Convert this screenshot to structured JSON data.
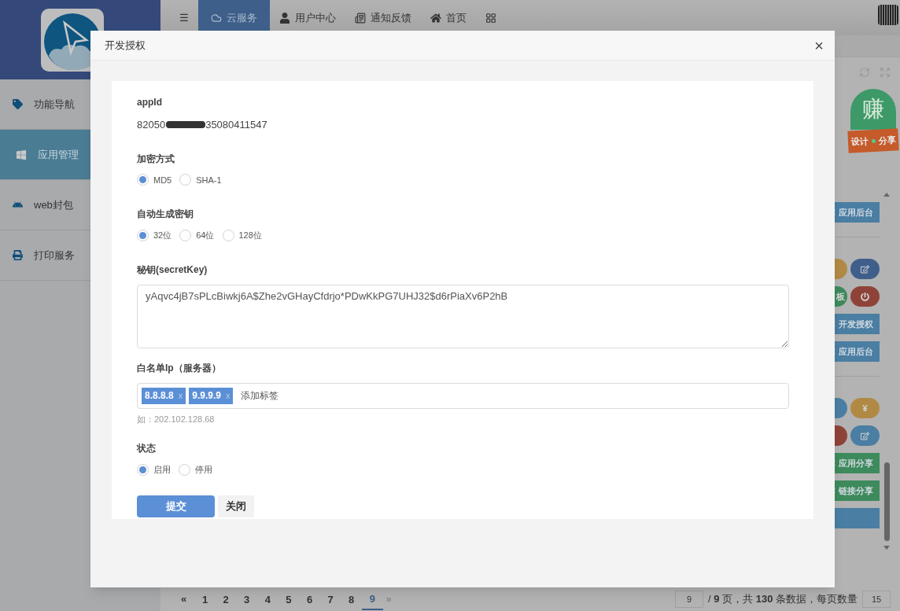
{
  "sidebar": {
    "items": [
      {
        "label": "功能导航",
        "selected": false
      },
      {
        "label": "应用管理",
        "selected": true
      },
      {
        "label": "web封包",
        "selected": false
      },
      {
        "label": "打印服务",
        "selected": false
      }
    ]
  },
  "top_nav": {
    "items": [
      {
        "label": "☰",
        "selected": false
      },
      {
        "label": "云服务",
        "selected": true
      },
      {
        "label": "用户中心",
        "selected": false
      },
      {
        "label": "通知反馈",
        "selected": false
      },
      {
        "label": "首页",
        "selected": false
      },
      {
        "selected": false
      }
    ]
  },
  "promo_badge": {
    "main": "赚",
    "left": "设计",
    "right": "分享"
  },
  "background_actions": [
    {
      "kind": "bar",
      "color": "#4a7ea3",
      "label": "应用后台"
    },
    {
      "kind": "divider"
    },
    {
      "kind": "pills",
      "left": {
        "color": "#b08a45"
      },
      "right": {
        "color": "#3f5f8a",
        "kind": "edit"
      }
    },
    {
      "kind": "pills",
      "left": {
        "color": "#3d8a5c",
        "label": "板"
      },
      "right": {
        "color": "#8f4338",
        "kind": "power"
      }
    },
    {
      "kind": "bar",
      "color": "#4a7ea3",
      "label": "开发授权"
    },
    {
      "kind": "bar",
      "color": "#4a7ea3",
      "label": "应用后台"
    },
    {
      "kind": "divider"
    },
    {
      "kind": "pills",
      "left": {
        "color": "#4a7ea3"
      },
      "right": {
        "color": "#b08a45",
        "label": "¥"
      }
    },
    {
      "kind": "pills",
      "left": {
        "color": "#8f4338"
      },
      "right": {
        "color": "#4a7ea3",
        "kind": "edit"
      }
    },
    {
      "kind": "bar",
      "color": "#3d8a5c",
      "label": "应用分享"
    },
    {
      "kind": "bar",
      "color": "#3d8a5c",
      "label": "链接分享"
    },
    {
      "kind": "bar",
      "color": "#4a7ea3"
    }
  ],
  "pagination": {
    "prev": "«",
    "pages": [
      {
        "label": "1",
        "selected": false
      },
      {
        "label": "2",
        "selected": false
      },
      {
        "label": "3",
        "selected": false
      },
      {
        "label": "4",
        "selected": false
      },
      {
        "label": "5",
        "selected": false
      },
      {
        "label": "6",
        "selected": false
      },
      {
        "label": "7",
        "selected": false
      },
      {
        "label": "8",
        "selected": false
      },
      {
        "label": "9",
        "selected": true
      }
    ],
    "next": "»",
    "page_input": "9",
    "summary": "/ **9** 页，共 **130** 条数据，每页数量",
    "page_size": "15"
  },
  "dialog": {
    "title": "开发授权",
    "close": "×",
    "appid": {
      "label": "appId",
      "value_prefix": "82050",
      "value_suffix": "35080411547"
    },
    "encryption": {
      "label": "加密方式",
      "options": [
        {
          "label": "MD5",
          "selected": true
        },
        {
          "label": "SHA-1",
          "selected": false
        }
      ]
    },
    "key_length": {
      "label": "自动生成密钥",
      "options": [
        {
          "label": "32位",
          "selected": true
        },
        {
          "label": "64位",
          "selected": false
        },
        {
          "label": "128位",
          "selected": false
        }
      ]
    },
    "secret": {
      "label": "秘钥(secretKey)",
      "value": "yAqvc4jB7sPLcBiwkj6A$Zhe2vGHayCfdrjo*PDwKkPG7UHJ32$d6rPiaXv6P2hB"
    },
    "whitelist": {
      "label": "白名单Ip（服务器）",
      "tags": [
        {
          "label": "8.8.8.8",
          "remove": "x"
        },
        {
          "label": "9.9.9.9",
          "remove": "x"
        }
      ],
      "placeholder": "添加标签",
      "hint": "如：202.102.128.68"
    },
    "status": {
      "label": "状态",
      "options": [
        {
          "label": "启用",
          "selected": true
        },
        {
          "label": "停用",
          "selected": false
        }
      ]
    },
    "buttons": [
      {
        "label": "提交",
        "kind": "primary"
      },
      {
        "label": "关闭",
        "kind": "secondary"
      }
    ]
  }
}
